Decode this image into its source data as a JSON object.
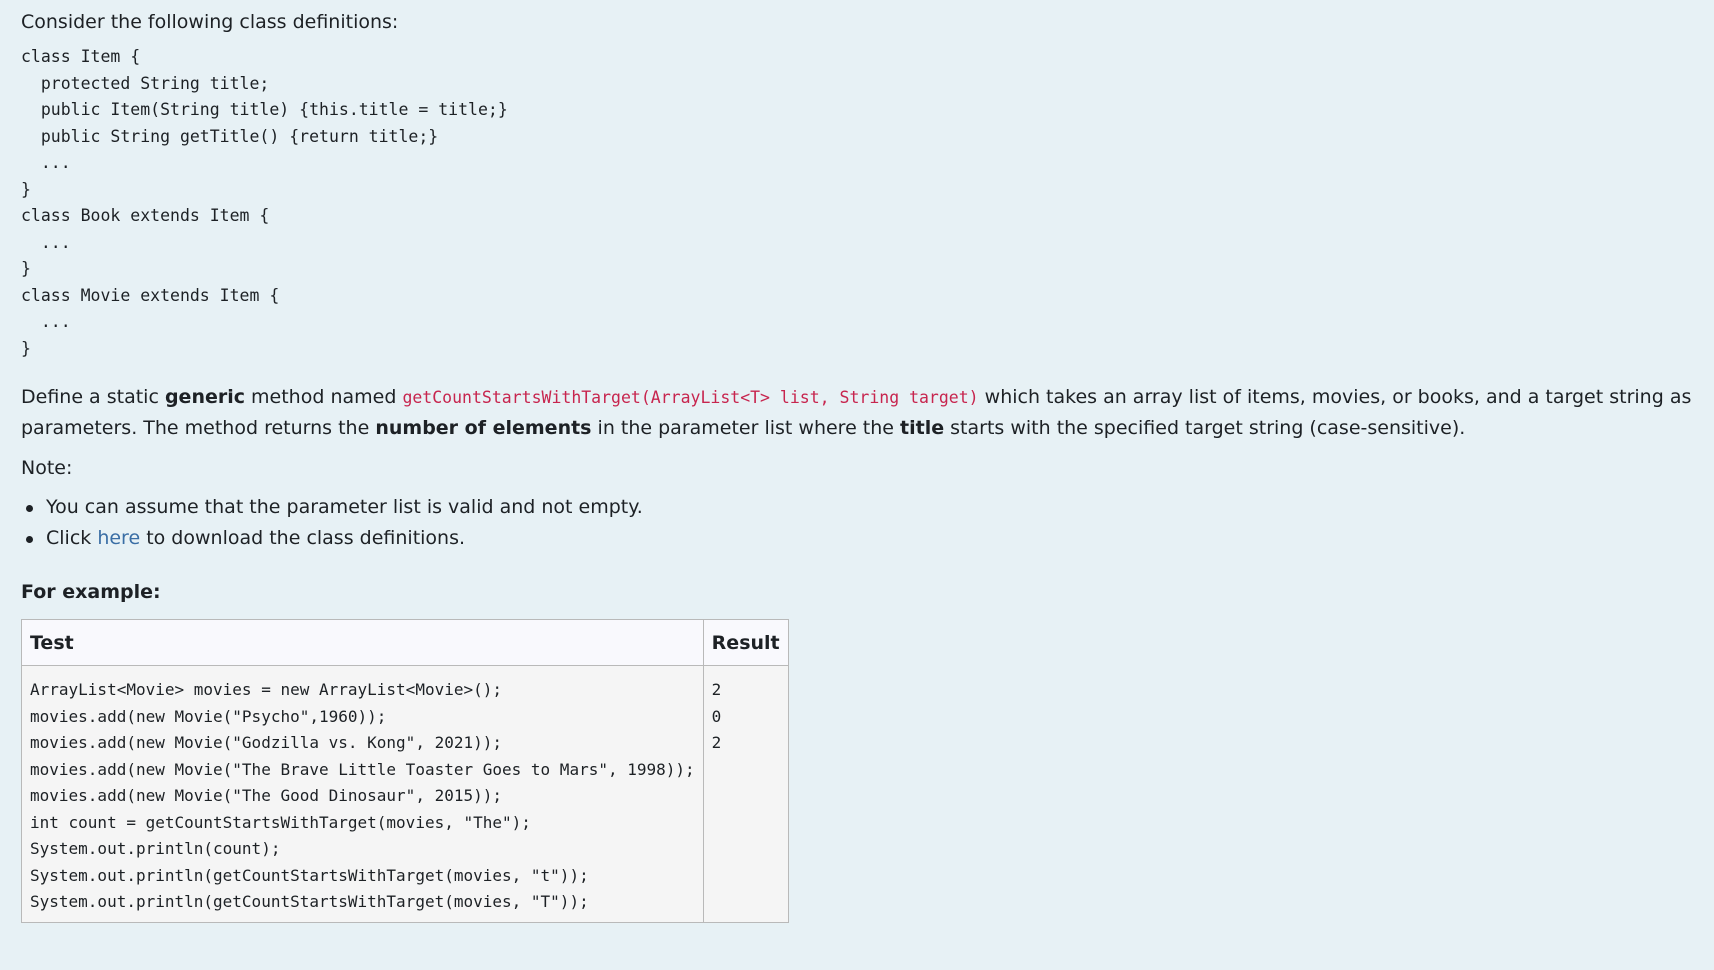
{
  "intro": "Consider the following class definitions:",
  "class_definitions": "class Item {\n  protected String title;\n  public Item(String title) {this.title = title;}\n  public String getTitle() {return title;}\n  ...\n}\nclass Book extends Item {\n  ...\n}\nclass Movie extends Item {\n  ...\n}",
  "description": {
    "part1": "Define a static ",
    "bold1": "generic",
    "part2": " method named ",
    "method_signature": "getCountStartsWithTarget(ArrayList<T> list, String target)",
    "part3": " which takes an array list of items, movies, or books, and a target string as parameters. The method returns the ",
    "bold2": "number of elements",
    "part4": " in the parameter list where the ",
    "bold3": "title",
    "part5": " starts with the specified target string (case-sensitive)."
  },
  "note_label": "Note:",
  "notes": {
    "item1": "You can assume that the parameter list is valid and not empty.",
    "item2_prefix": "Click ",
    "item2_link": "here",
    "item2_suffix": " to download the class definitions."
  },
  "example_heading": "For example:",
  "example_table": {
    "headers": [
      "Test",
      "Result"
    ],
    "test_code": "ArrayList<Movie> movies = new ArrayList<Movie>();\nmovies.add(new Movie(\"Psycho\",1960));\nmovies.add(new Movie(\"Godzilla vs. Kong\", 2021));\nmovies.add(new Movie(\"The Brave Little Toaster Goes to Mars\", 1998));\nmovies.add(new Movie(\"The Good Dinosaur\", 2015));\nint count = getCountStartsWithTarget(movies, \"The\");\nSystem.out.println(count);\nSystem.out.println(getCountStartsWithTarget(movies, \"t\"));\nSystem.out.println(getCountStartsWithTarget(movies, \"T\"));",
    "result": "2\n0\n2"
  }
}
